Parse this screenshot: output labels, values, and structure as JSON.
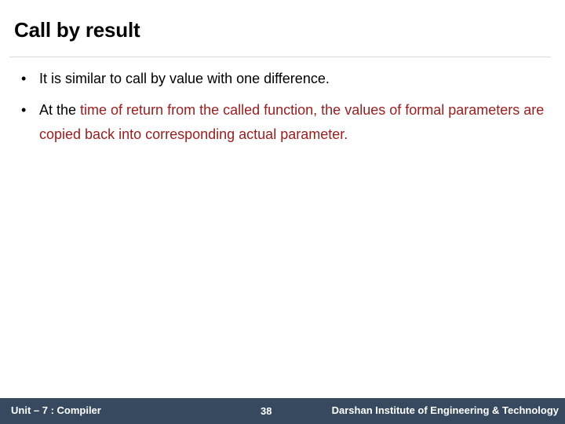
{
  "slide": {
    "title": "Call by result",
    "background_color": "#ffffff",
    "divider_color": "#dcdcdc",
    "bullets": [
      {
        "marker": "•",
        "segments": [
          {
            "text": "It is similar to call by value with one difference.",
            "color": "#000000"
          }
        ]
      },
      {
        "marker": "•",
        "segments": [
          {
            "text": "At the ",
            "color": "#000000"
          },
          {
            "text": "time of return from the called function, the values of formal parameters are copied back into corresponding actual parameter.",
            "color": "#9c1b1b"
          }
        ]
      }
    ]
  },
  "footer": {
    "background_color": "#36495e",
    "unit_label": "Unit – 7 : Compiler",
    "page_number": "38",
    "institute": "Darshan Institute of Engineering & Technology"
  }
}
